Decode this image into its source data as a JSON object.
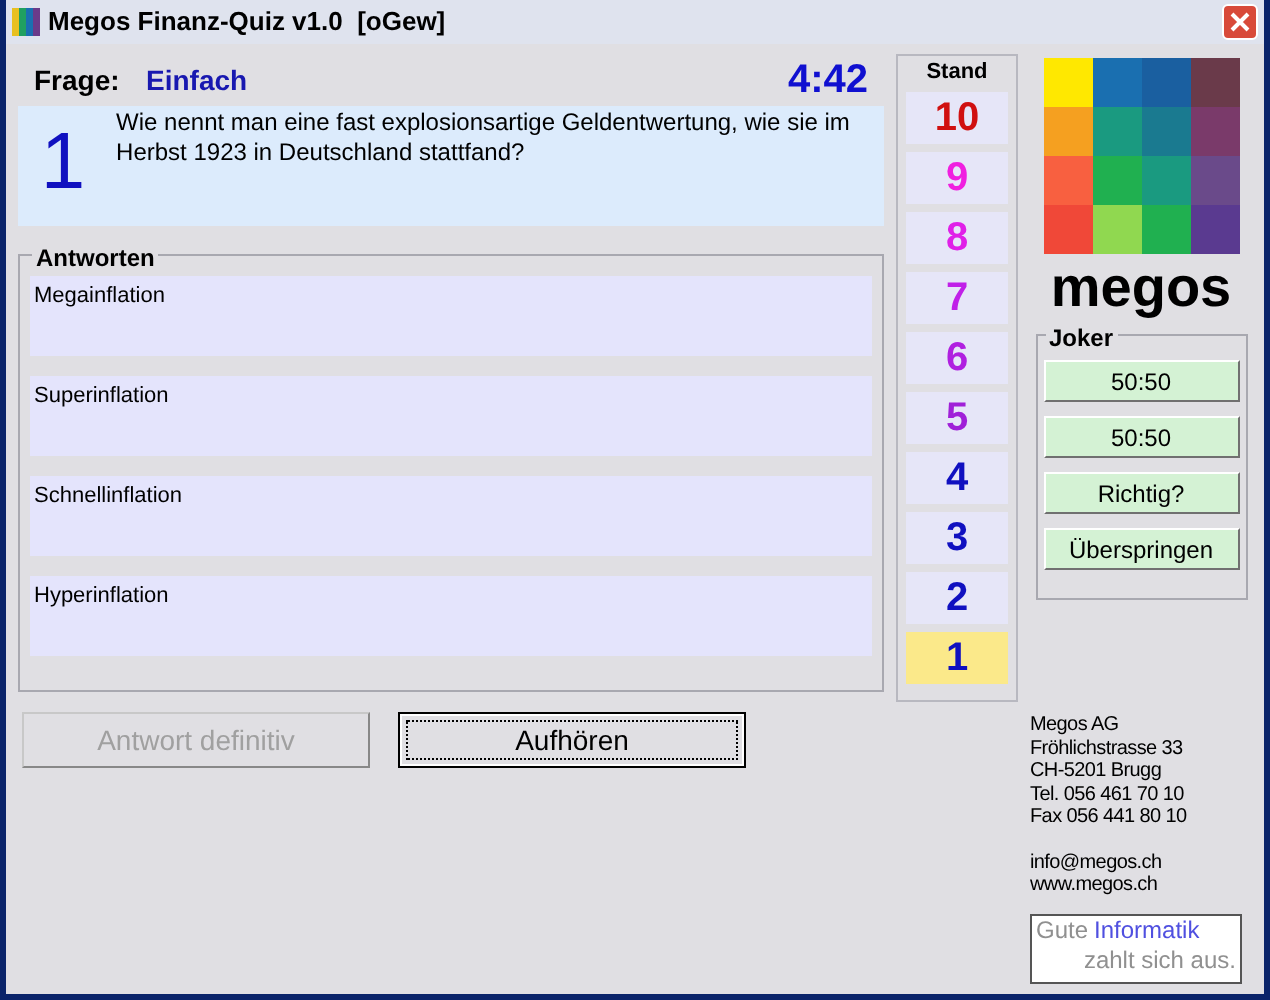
{
  "window": {
    "title": "Megos Finanz-Quiz v1.0  [oGew]"
  },
  "question": {
    "label": "Frage:",
    "difficulty": "Einfach",
    "timer": "4:42",
    "number": "1",
    "text": "Wie nennt man eine fast explosionsartige Geldentwertung, wie sie im Herbst 1923 in Deutschland stattfand?"
  },
  "answers": {
    "title": "Antworten",
    "items": [
      "Megainflation",
      "Superinflation",
      "Schnellinflation",
      "Hyperinflation"
    ]
  },
  "ladder": {
    "title": "Stand",
    "levels": [
      {
        "label": "10",
        "color": "#d01010",
        "selected": false
      },
      {
        "label": "9",
        "color": "#f020e0",
        "selected": false
      },
      {
        "label": "8",
        "color": "#e020e8",
        "selected": false
      },
      {
        "label": "7",
        "color": "#c020e8",
        "selected": false
      },
      {
        "label": "6",
        "color": "#b020e0",
        "selected": false
      },
      {
        "label": "5",
        "color": "#a020d8",
        "selected": false
      },
      {
        "label": "4",
        "color": "#1010c0",
        "selected": false
      },
      {
        "label": "3",
        "color": "#1010c0",
        "selected": false
      },
      {
        "label": "2",
        "color": "#1010c0",
        "selected": false
      },
      {
        "label": "1",
        "color": "#1010c0",
        "selected": true
      }
    ]
  },
  "brand": {
    "name": "megos"
  },
  "joker": {
    "title": "Joker",
    "buttons": [
      {
        "label": "50:50"
      },
      {
        "label": "50:50"
      },
      {
        "label": "Richtig?"
      },
      {
        "label": "Überspringen"
      }
    ]
  },
  "actions": [
    {
      "label": "Antwort definitiv",
      "disabled": true
    },
    {
      "label": "Aufhören",
      "disabled": false
    }
  ],
  "contact": {
    "lines": [
      "Megos AG",
      "Fröhlichstrasse 33",
      "CH-5201 Brugg",
      "Tel. 056 461 70 10",
      "Fax 056 441 80 10"
    ],
    "web": [
      "info@megos.ch",
      "www.megos.ch"
    ]
  },
  "slogan": {
    "first": "Gute",
    "highlight": "Informatik",
    "second": "zahlt sich aus."
  }
}
